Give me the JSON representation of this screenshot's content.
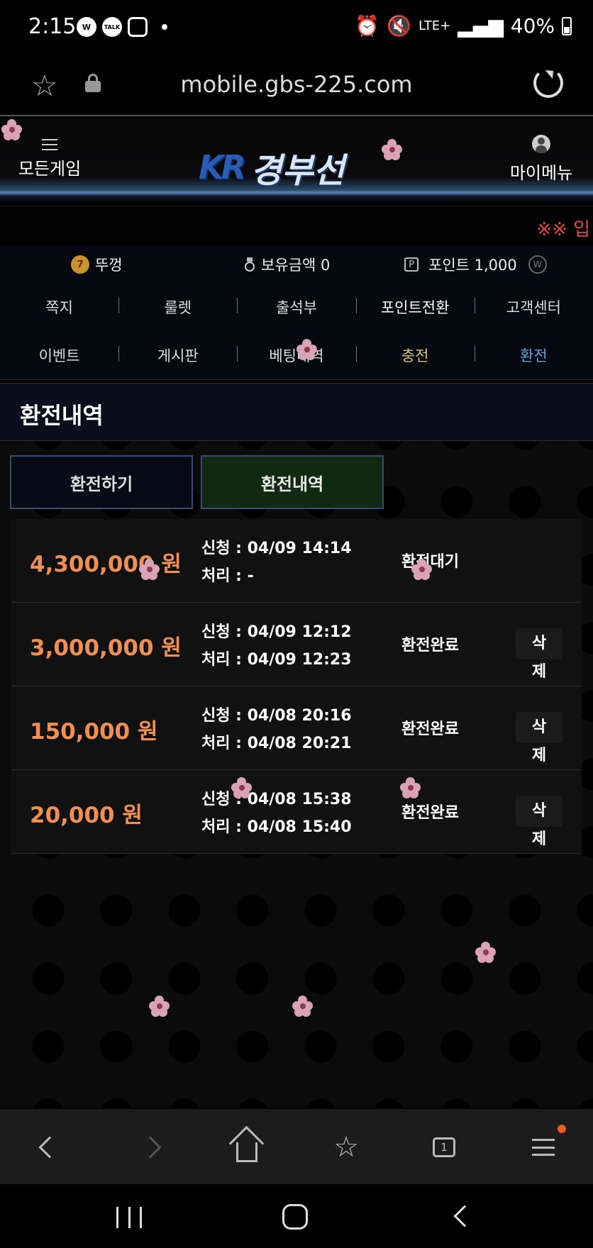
{
  "status_bar": {
    "time": "2:15",
    "notif_icons": [
      "W",
      "TALK",
      "instagram"
    ],
    "network": "LTE+",
    "battery": "40%"
  },
  "browser": {
    "url": "mobile.gbs-225.com"
  },
  "header": {
    "menu_label": "모든게임",
    "logo_mark": "KR",
    "logo_text": "경부선",
    "my_menu_label": "마이메뉴"
  },
  "ticker": {
    "text": "※※ 입"
  },
  "user": {
    "nickname": "뚜껑",
    "level_badge": "7",
    "balance": "보유금액 0",
    "points_label": "포인트 1,000",
    "w_badge": "W"
  },
  "nav": {
    "row1": [
      "쪽지",
      "룰렛",
      "출석부",
      "포인트전환",
      "고객센터"
    ],
    "row2": [
      "이벤트",
      "게시판",
      "베팅내역",
      "충전",
      "환전"
    ]
  },
  "page": {
    "title": "환전내역",
    "tabs": [
      "환전하기",
      "환전내역"
    ]
  },
  "withdrawals": [
    {
      "amount": "4,300,000 원",
      "requested": "신청 : 04/09 14:14",
      "processed": "처리 : -",
      "status": "환전대기",
      "delete_label": ""
    },
    {
      "amount": "3,000,000 원",
      "requested": "신청 : 04/09 12:12",
      "processed": "처리 : 04/09 12:23",
      "status": "환전완료",
      "delete_label": "삭제"
    },
    {
      "amount": "150,000 원",
      "requested": "신청 : 04/08 20:16",
      "processed": "처리 : 04/08 20:21",
      "status": "환전완료",
      "delete_label": "삭제"
    },
    {
      "amount": "20,000 원",
      "requested": "신청 : 04/08 15:38",
      "processed": "처리 : 04/08 15:40",
      "status": "환전완료",
      "delete_label": "삭제"
    }
  ],
  "browser_bottom": {
    "tabs_count": "1"
  },
  "colors": {
    "amount": "#ef8e55",
    "ticker": "#e04a3a",
    "tab_active_bg": "#0f2a10",
    "nav_charge": "#d8c27a",
    "nav_withdraw": "#5aa3d6"
  }
}
